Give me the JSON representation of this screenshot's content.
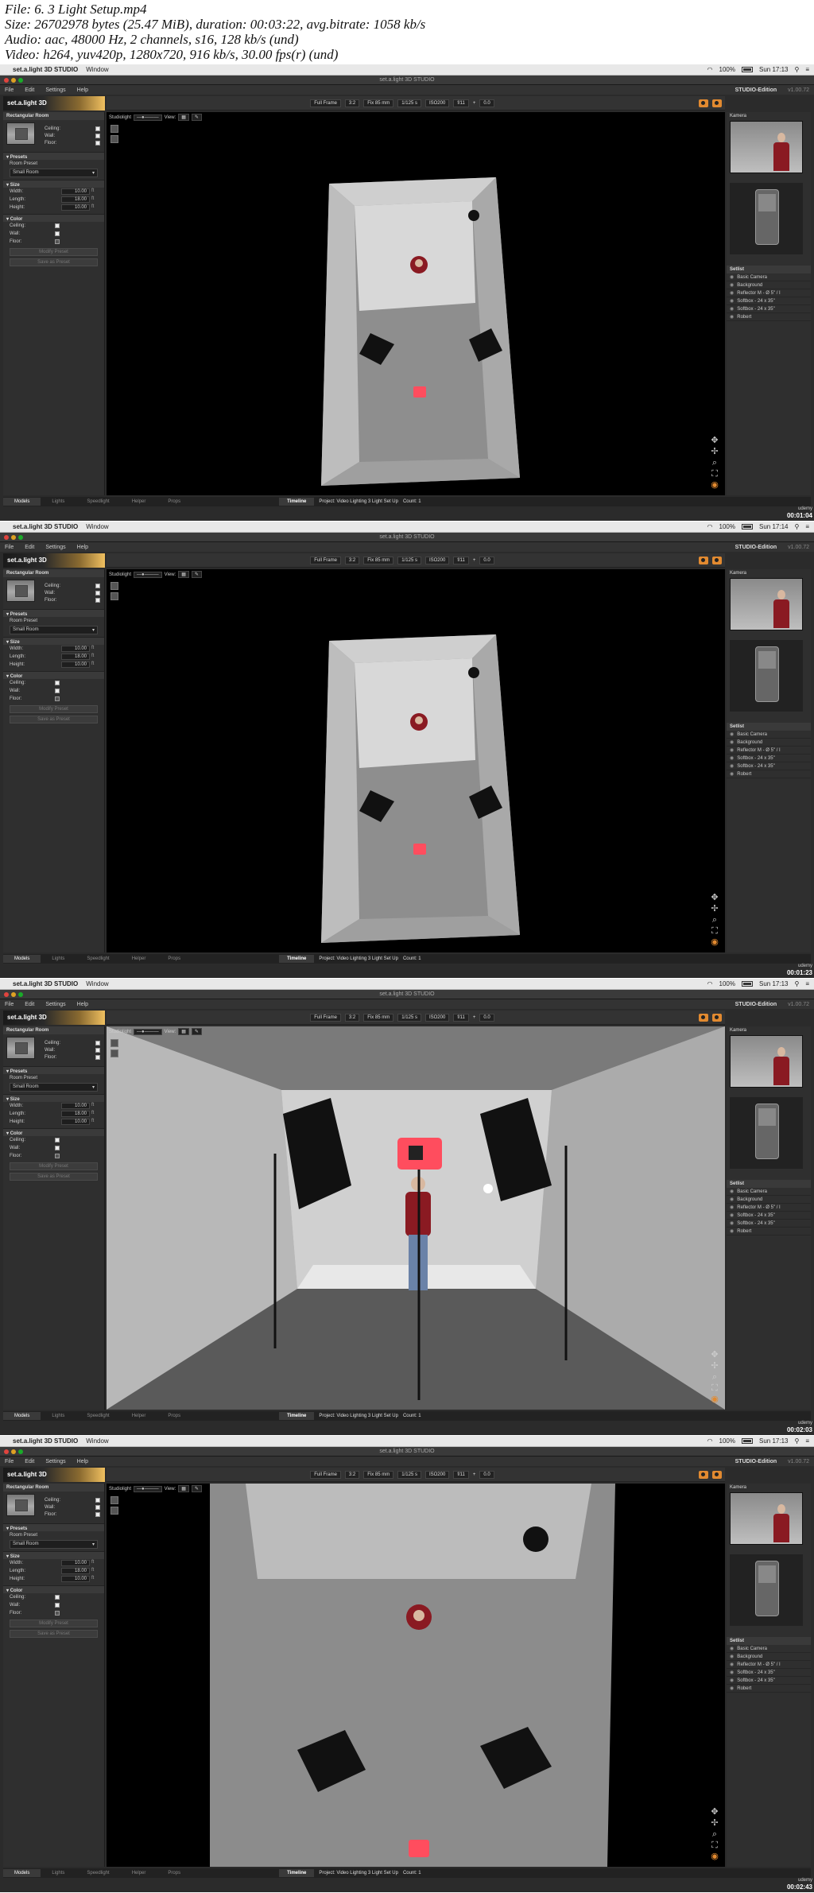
{
  "header": {
    "line1": "File: 6. 3 Light Setup.mp4",
    "line2": "Size: 26702978 bytes (25.47 MiB), duration: 00:03:22, avg.bitrate: 1058 kb/s",
    "line3": "Audio: aac, 48000 Hz, 2 channels, s16, 128 kb/s (und)",
    "line4": "Video: h264, yuv420p, 1280x720, 916 kb/s, 30.00 fps(r) (und)"
  },
  "app": {
    "name": "set.a.light 3D STUDIO",
    "window_menu": "Window",
    "title": "set.a.light 3D STUDIO",
    "menu": [
      "File",
      "Edit",
      "Settings",
      "Help"
    ],
    "edition": "STUDIO-Edition",
    "version": "v1.00.72",
    "logo": "set.a.light 3D",
    "battery": "100%"
  },
  "toolbar": {
    "full_frame": "Full Frame",
    "ratio": "3:2",
    "lens": "Fix 85 mm",
    "shutter": "1/125 s",
    "iso": "ISO200",
    "aperture": "f/11",
    "ev": "0.0"
  },
  "left": {
    "title": "Rectangular Room",
    "ceiling": "Ceiling:",
    "wall": "Wall:",
    "floor": "Floor:",
    "presets": "Presets",
    "room_preset": "Room Preset",
    "preset_value": "Small Room",
    "size": "Size",
    "width": "Width:",
    "width_val": "10.00",
    "length": "Length:",
    "length_val": "18.00",
    "height": "Height:",
    "height_val": "10.00",
    "unit": "ft",
    "color": "Color",
    "modify": "Modify Preset",
    "save": "Save as Preset"
  },
  "viewport": {
    "studiolight": "Studiolight",
    "view": "View:"
  },
  "tabs": {
    "models": "Models",
    "lights": "Lights",
    "speedlight": "Speedlight",
    "helper": "Helper",
    "props": "Props",
    "timeline": "Timeline",
    "project": "Project: Video Lighting 3 Light Set Up",
    "count": "Count: 1"
  },
  "right": {
    "kamera": "Kamera",
    "setlist": "Setlist",
    "items": [
      "Basic Camera",
      "Background",
      "Reflector M - Ø 5\" / I",
      "Softbox - 24 x 35\"",
      "Softbox - 24 x 35\"",
      "Robert"
    ]
  },
  "frames": [
    {
      "time": "Sun 17:13",
      "timecode": "00:01:04"
    },
    {
      "time": "Sun 17:14",
      "timecode": "00:01:23"
    },
    {
      "time": "Sun 17:13",
      "timecode": "00:02:03"
    },
    {
      "time": "Sun 17:13",
      "timecode": "00:02:43"
    }
  ],
  "watermark": "udemy",
  "colors": {
    "accent": "#e28a30",
    "camera_red": "#ff4d5e",
    "suit_red": "#8a1a22"
  }
}
